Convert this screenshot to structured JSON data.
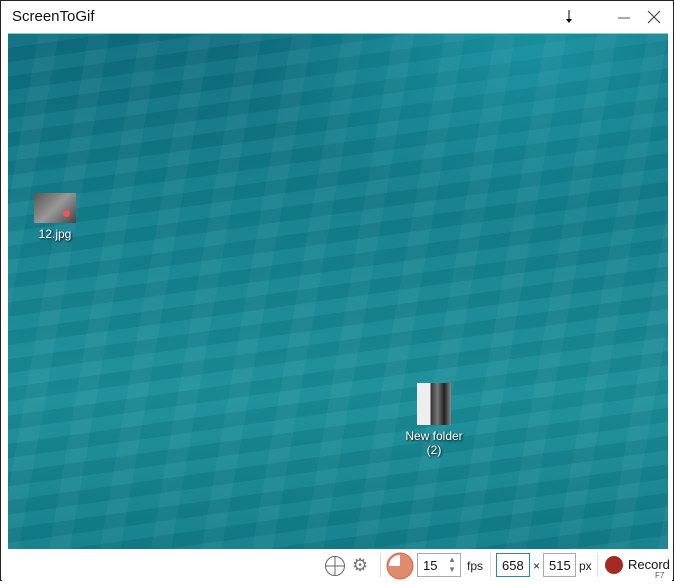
{
  "window": {
    "title": "ScreenToGif"
  },
  "desktop": {
    "icons": [
      {
        "label": "12.jpg"
      },
      {
        "label": "New folder\n(2)",
        "line1": "New folder",
        "line2": "(2)"
      }
    ]
  },
  "toolbar": {
    "fps_value": "15",
    "fps_unit": "fps",
    "width_value": "658",
    "times": "×",
    "height_value": "515",
    "px_unit": "px",
    "record_label": "Record",
    "record_shortcut": "F7",
    "record_color": "#a52a1f",
    "accent": "#e08a6e"
  }
}
